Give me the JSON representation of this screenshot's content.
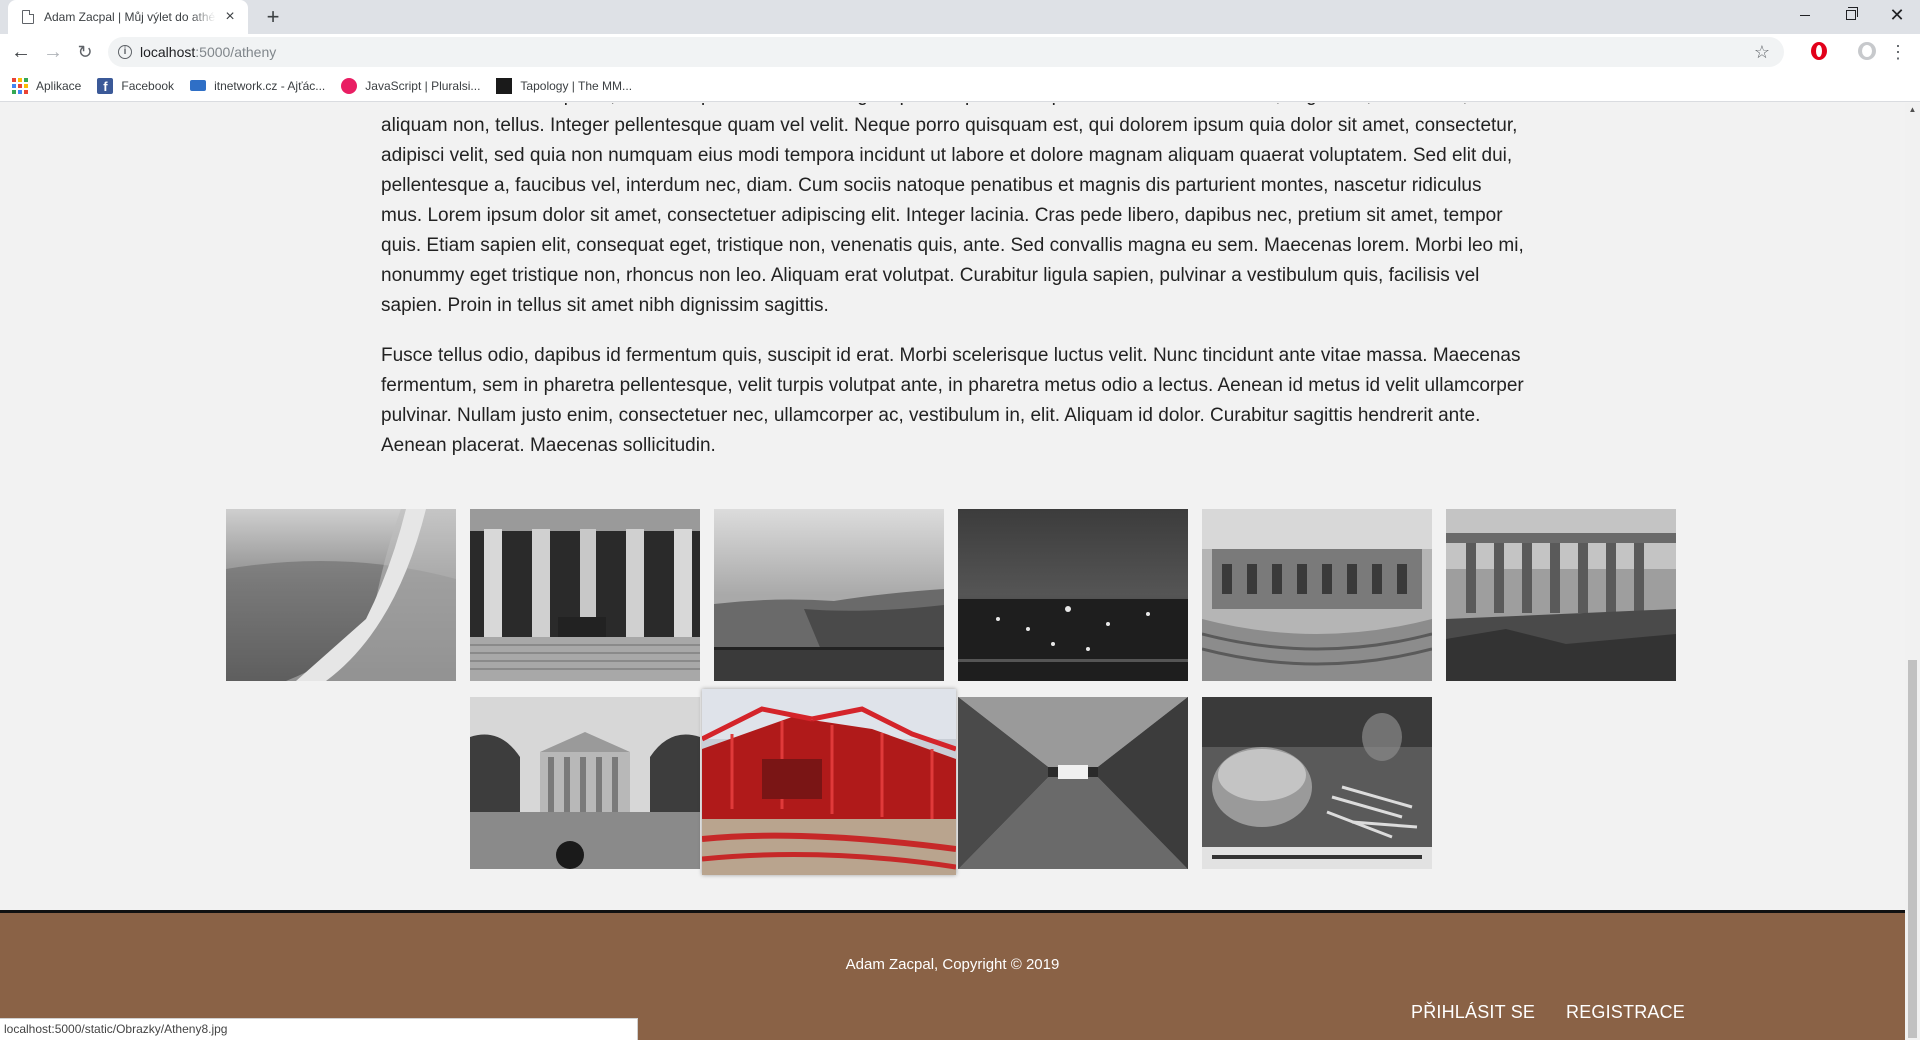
{
  "browser": {
    "tab_title": "Adam Zacpal | Můj výlet do athén",
    "url_host": "localhost",
    "url_path": ":5000/atheny",
    "bookmarks": [
      {
        "label": "Aplikace",
        "icon": "apps-grid-icon"
      },
      {
        "label": "Facebook",
        "icon": "facebook-icon"
      },
      {
        "label": "itnetwork.cz - Ajťác...",
        "icon": "laptop-icon"
      },
      {
        "label": "JavaScript | Pluralsi...",
        "icon": "pluralsight-icon"
      },
      {
        "label": "Tapology | The MM...",
        "icon": "tapology-icon"
      }
    ],
    "status_url": "localhost:5000/static/Obrazky/Atheny8.jpg"
  },
  "article": {
    "paragraph_1": "nihil molestiae consequatur, vel illum qui dolorem eum fugiat quo voluptas nulla pariatur? Mauris dolor felis, sagittis at, luctus sed, aliquam non, tellus. Integer pellentesque quam vel velit. Neque porro quisquam est, qui dolorem ipsum quia dolor sit amet, consectetur, adipisci velit, sed quia non numquam eius modi tempora incidunt ut labore et dolore magnam aliquam quaerat voluptatem. Sed elit dui, pellentesque a, faucibus vel, interdum nec, diam. Cum sociis natoque penatibus et magnis dis parturient montes, nascetur ridiculus mus. Lorem ipsum dolor sit amet, consectetuer adipiscing elit. Integer lacinia. Cras pede libero, dapibus nec, pretium sit amet, tempor quis. Etiam sapien elit, consequat eget, tristique non, venenatis quis, ante. Sed convallis magna eu sem. Maecenas lorem. Morbi leo mi, nonummy eget tristique non, rhoncus non leo. Aliquam erat volutpat. Curabitur ligula sapien, pulvinar a vestibulum quis, facilisis vel sapien. Proin in tellus sit amet nibh dignissim sagittis.",
    "paragraph_2": "Fusce tellus odio, dapibus id fermentum quis, suscipit id erat. Morbi scelerisque luctus velit. Nunc tincidunt ante vitae massa. Maecenas fermentum, sem in pharetra pellentesque, velit turpis volutpat ante, in pharetra metus odio a lectus. Aenean id metus id velit ullamcorper pulvinar. Nullam justo enim, consectetuer nec, ullamcorper ac, vestibulum in, elit. Aliquam id dolor. Curabitur sagittis hendrerit ante. Aenean placerat. Maecenas sollicitudin."
  },
  "gallery": {
    "photos": [
      {
        "subject": "airplane-wing-photo",
        "style": "grayscale"
      },
      {
        "subject": "university-columns-photo",
        "style": "grayscale"
      },
      {
        "subject": "coastline-photo",
        "style": "grayscale"
      },
      {
        "subject": "city-night-photo",
        "style": "grayscale"
      },
      {
        "subject": "odeon-theatre-photo",
        "style": "grayscale"
      },
      {
        "subject": "parthenon-photo",
        "style": "grayscale"
      },
      {
        "subject": "academy-building-photo",
        "style": "grayscale"
      },
      {
        "subject": "stadium-photo",
        "style": "color",
        "state": "hovered"
      },
      {
        "subject": "tunnel-photo",
        "style": "grayscale"
      },
      {
        "subject": "burger-fries-photo",
        "style": "grayscale"
      }
    ]
  },
  "footer": {
    "copyright": "Adam Zacpal, Copyright © 2019",
    "login_label": "PŘIHLÁSIT SE",
    "register_label": "REGISTRACE",
    "background_color": "#8a6246"
  }
}
